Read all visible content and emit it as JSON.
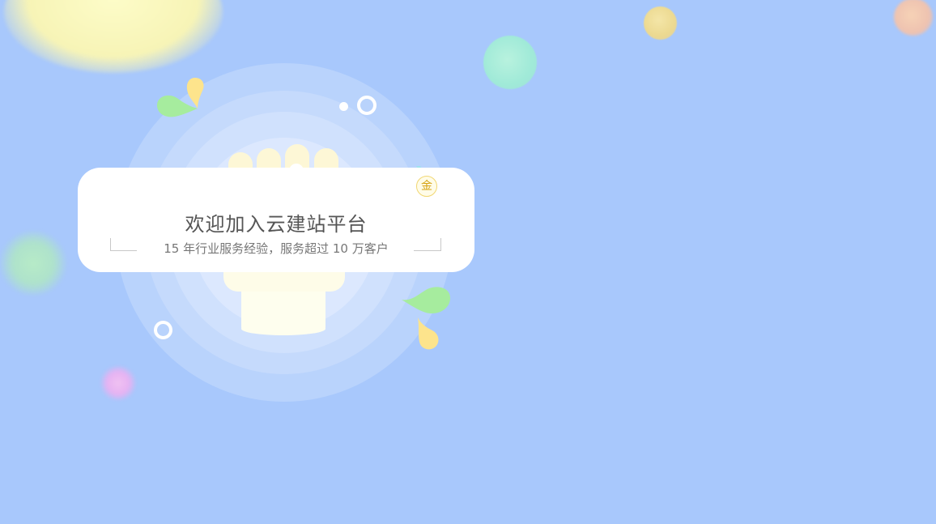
{
  "card": {
    "title": "欢迎加入云建站平台",
    "subtitle": "15 年行业服务经验，服务超过 10 万客户"
  },
  "badge": {
    "label": "金"
  },
  "colors": {
    "background": "#a8c8fc",
    "card": "#ffffff",
    "title_text": "#555555",
    "subtitle_text": "#777777",
    "badge_accent": "#d6a414",
    "leaf_green": "#a6ec9e",
    "drop_yellow": "#fde48c"
  },
  "icons": {
    "hand": "raised-fist-icon",
    "badge": "gold-medal-icon",
    "leaf": "leaf-icon",
    "drop": "drop-icon",
    "ring": "ring-icon"
  }
}
